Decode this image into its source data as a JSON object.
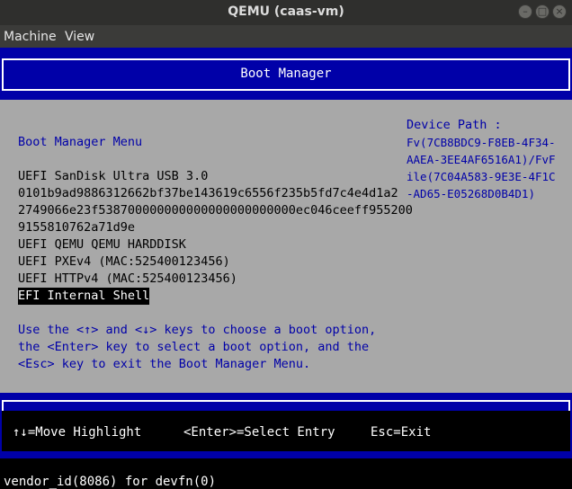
{
  "window": {
    "title": "QEMU (caas-vm)"
  },
  "menubar": {
    "items": [
      "Machine",
      "View"
    ]
  },
  "header": {
    "title": "Boot Manager"
  },
  "content": {
    "menu_title": "Boot Manager Menu",
    "entries": [
      "UEFI SanDisk Ultra USB 3.0",
      "0101b9ad9886312662bf37be143619c6556f235b5fd7c4e4d1a2",
      "2749066e23f538700000000000000000000000ec046ceeff955200",
      "9155810762a71d9e",
      "UEFI QEMU QEMU HARDDISK",
      "UEFI PXEv4 (MAC:525400123456)",
      "UEFI HTTPv4 (MAC:525400123456)",
      "EFI Internal Shell"
    ],
    "selected_entry": "EFI Internal Shell",
    "help_lines": [
      "Use the <↑> and <↓> keys to choose a boot option,",
      "the <Enter> key to select a boot option, and the",
      "<Esc> key to exit the Boot Manager Menu."
    ],
    "device_path_label": "Device Path :",
    "device_path_lines": [
      "Fv(7CB8BDC9-F8EB-4F34-",
      "AAEA-3EE4AF6516A1)/FvF",
      "ile(7C04A583-9E3E-4F1C",
      "-AD65-E05268D0B4D1)"
    ]
  },
  "footer": {
    "move": "↑↓=Move Highlight",
    "select": "<Enter>=Select Entry",
    "exit": "Esc=Exit"
  },
  "console_line": "vendor_id(8086) for devfn(0)"
}
